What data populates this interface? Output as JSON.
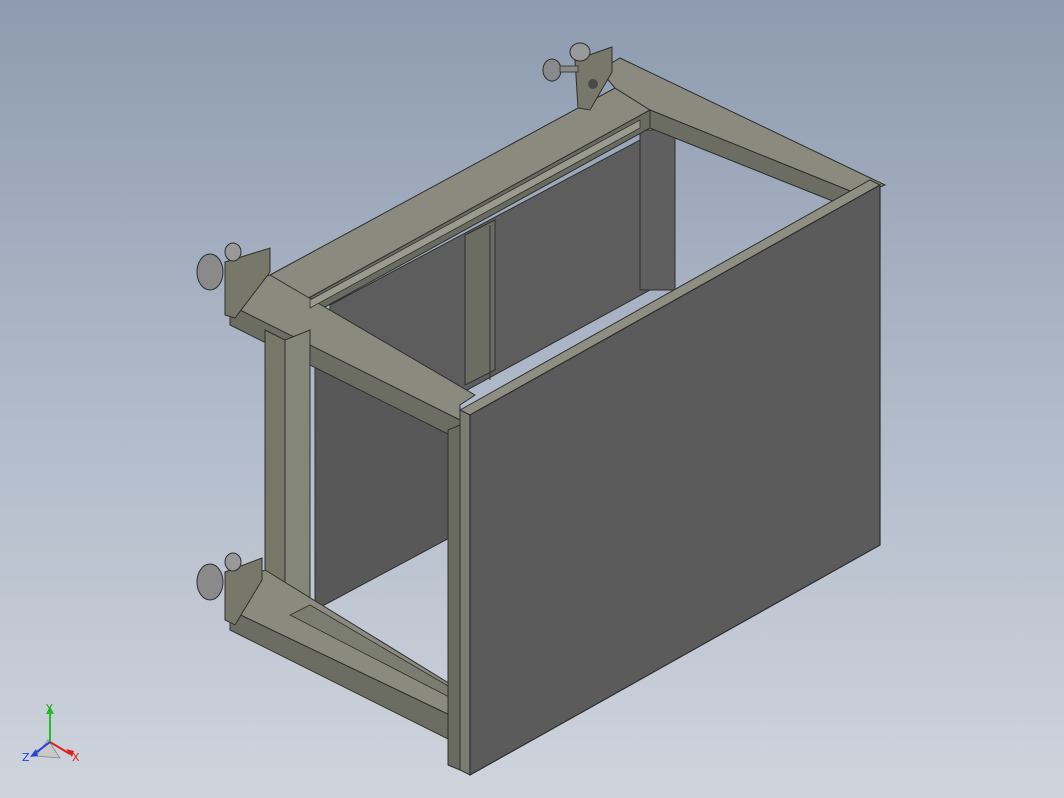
{
  "viewport": {
    "background_top": "#8e9bb0",
    "background_bottom": "#cfd4dc",
    "model_color": "#5a5a5a",
    "frame_color": "#6f7065"
  },
  "triad": {
    "x_label": "X",
    "y_label": "Y",
    "z_label": "Z",
    "x_color": "#e02020",
    "y_color": "#20c020",
    "z_color": "#2040e0"
  }
}
